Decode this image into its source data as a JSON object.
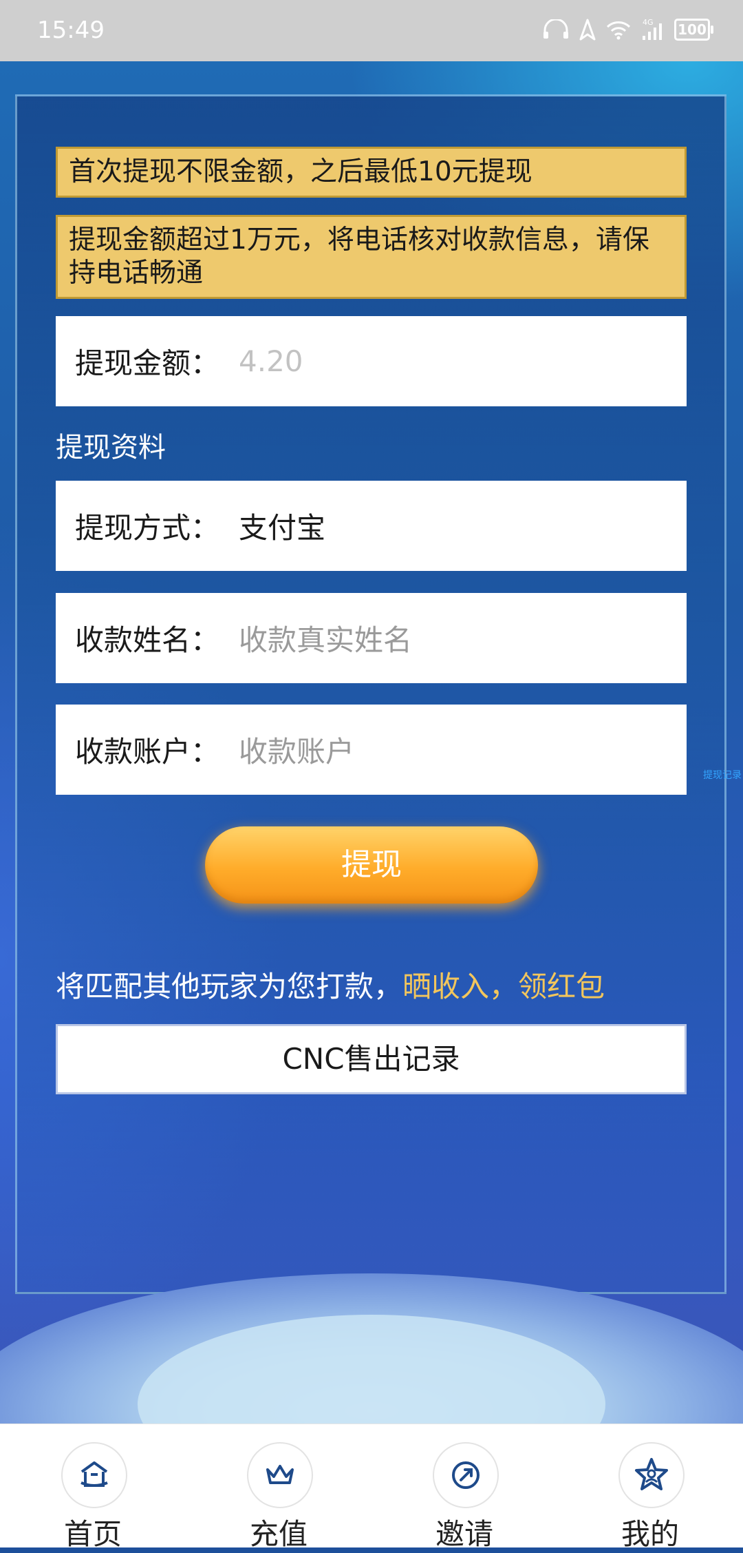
{
  "status_bar": {
    "time": "15:49",
    "network": "4G",
    "battery": "100"
  },
  "notices": [
    "首次提现不限金额，之后最低10元提现",
    "提现金额超过1万元，将电话核对收款信息，请保持电话畅通"
  ],
  "amount": {
    "label": "提现金额：",
    "value": "4.20"
  },
  "section_title": "提现资料",
  "method": {
    "label": "提现方式：",
    "value": "支付宝"
  },
  "name": {
    "label": "收款姓名：",
    "placeholder": "收款真实姓名"
  },
  "account": {
    "label": "收款账户：",
    "placeholder": "收款账户"
  },
  "withdraw_button": "提现",
  "match_text": {
    "prefix": "将匹配其他玩家为您打款，",
    "highlight": "晒收入，领红包"
  },
  "records_button": "CNC售出记录",
  "side_tag": "提现记录",
  "nav": [
    {
      "label": "首页",
      "icon": "home-icon"
    },
    {
      "label": "充值",
      "icon": "crown-icon"
    },
    {
      "label": "邀请",
      "icon": "invite-icon"
    },
    {
      "label": "我的",
      "icon": "star-user-icon"
    }
  ],
  "colors": {
    "notice_bg": "#eec96d",
    "button_orange": "#ffac2a",
    "highlight_text": "#f3c65c",
    "icon_blue": "#1e4a8a"
  }
}
